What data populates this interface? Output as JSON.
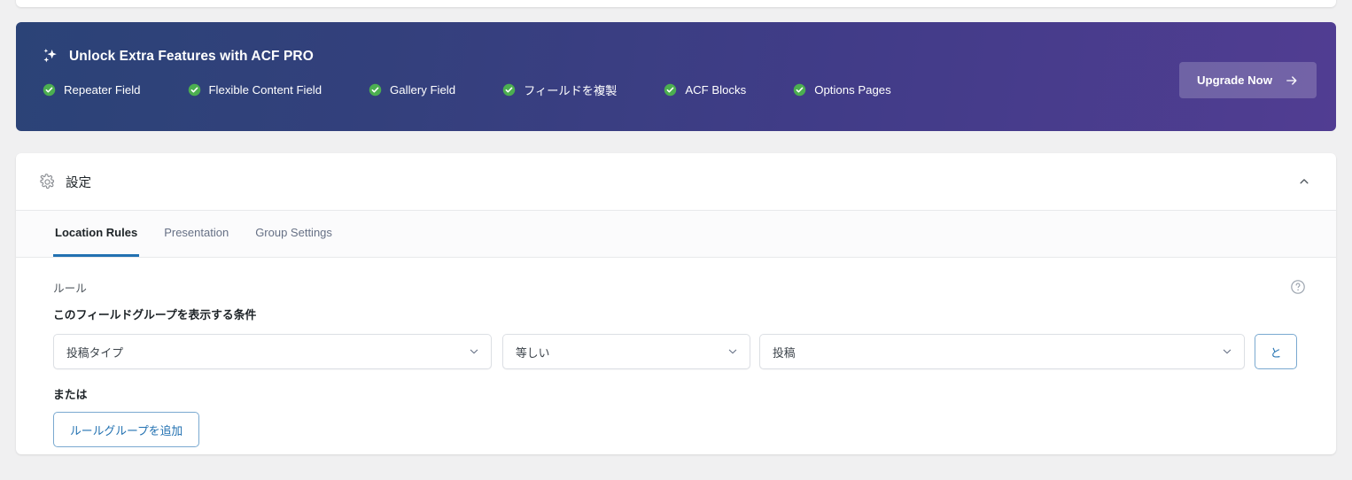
{
  "pro_banner": {
    "icon": "sparkles-icon",
    "title": "Unlock Extra Features with ACF PRO",
    "features": [
      {
        "icon": "check-circle-icon",
        "label": "Repeater Field"
      },
      {
        "icon": "check-circle-icon",
        "label": "Flexible Content Field"
      },
      {
        "icon": "check-circle-icon",
        "label": "Gallery Field"
      },
      {
        "icon": "check-circle-icon",
        "label": "フィールドを複製"
      },
      {
        "icon": "check-circle-icon",
        "label": "ACF Blocks"
      },
      {
        "icon": "check-circle-icon",
        "label": "Options Pages"
      }
    ],
    "upgrade_label": "Upgrade Now",
    "upgrade_icon": "arrow-right-icon",
    "gradient_start": "#2b4377",
    "gradient_end": "#513d92",
    "check_color": "#4caf50"
  },
  "settings_panel": {
    "icon": "gear-icon",
    "title": "設定",
    "collapse_icon": "chevron-up-icon",
    "tabs": [
      {
        "label": "Location Rules",
        "active": true
      },
      {
        "label": "Presentation",
        "active": false
      },
      {
        "label": "Group Settings",
        "active": false
      }
    ],
    "active_tab_color": "#2271b1",
    "rules": {
      "section_label": "ルール",
      "help_icon": "help-circle-icon",
      "heading": "このフィールドグループを表示する条件",
      "row": {
        "param": "投稿タイプ",
        "operator": "等しい",
        "value": "投稿",
        "chevron_icon": "chevron-down-icon",
        "and_label": "と"
      },
      "or_label": "または",
      "add_group_label": "ルールグループを追加",
      "link_color": "#2271b1"
    }
  }
}
